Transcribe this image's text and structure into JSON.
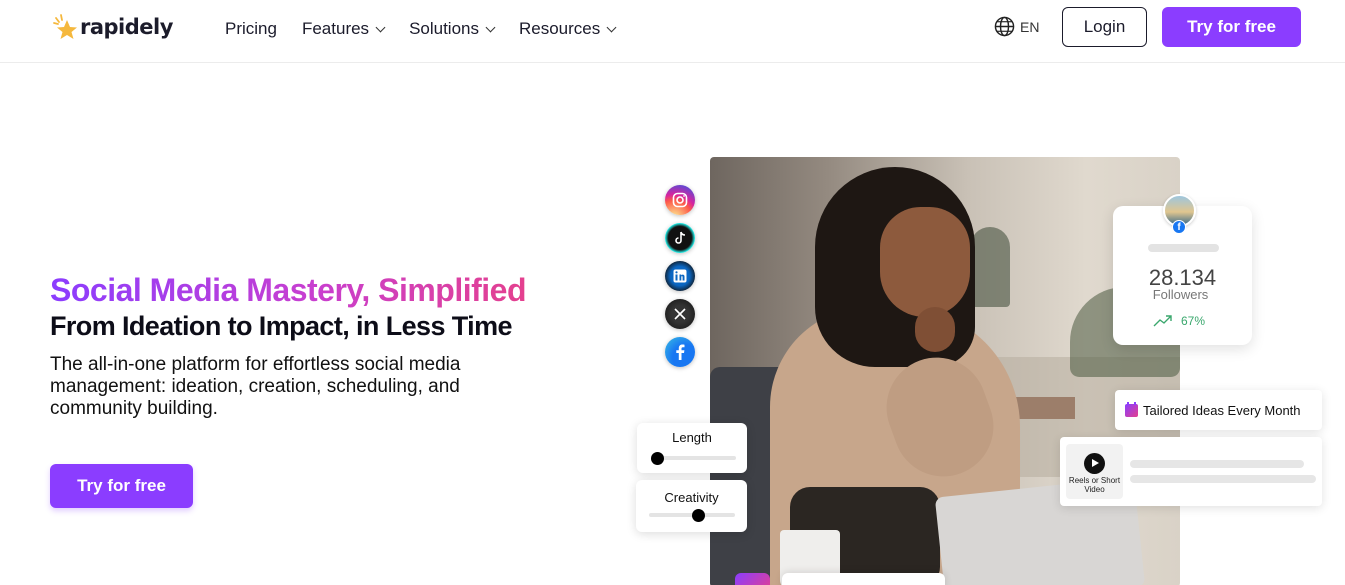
{
  "nav": {
    "logo_text": "rapidely",
    "menu": [
      {
        "label": "Pricing",
        "dropdown": false
      },
      {
        "label": "Features",
        "dropdown": true
      },
      {
        "label": "Solutions",
        "dropdown": true
      },
      {
        "label": "Resources",
        "dropdown": true
      }
    ],
    "language": "EN",
    "login_label": "Login",
    "try_label": "Try for free"
  },
  "hero": {
    "title": "Social Media Mastery, Simplified",
    "subtitle": "From Ideation to Impact, in Less Time",
    "description": "The all-in-one platform for effortless social media management: ideation, creation, scheduling, and community building.",
    "cta_label": "Try for free"
  },
  "social_icons": [
    "instagram-icon",
    "tiktok-icon",
    "linkedin-icon",
    "x-icon",
    "facebook-icon"
  ],
  "followers_card": {
    "count": "28.134",
    "label": "Followers",
    "trend": "67%"
  },
  "ideas_card": {
    "label": "Tailored Ideas Every Month"
  },
  "reels_card": {
    "label": "Reels or Short Video"
  },
  "sliders": {
    "length": {
      "label": "Length",
      "value": 0.05
    },
    "creativity": {
      "label": "Creativity",
      "value": 0.55
    }
  },
  "colors": {
    "brand_purple": "#8b3dff",
    "brand_pink": "#e4408e",
    "trend_green": "#3aa76d"
  }
}
